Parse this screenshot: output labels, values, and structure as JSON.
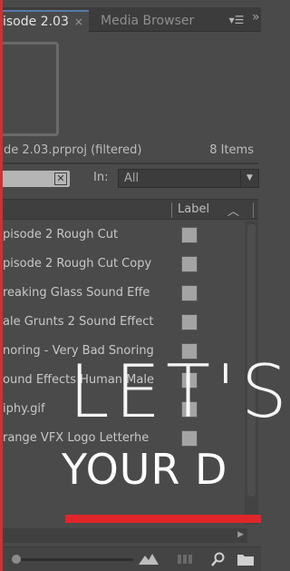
{
  "tabs": {
    "project_label": "isode 2.03",
    "close_glyph": "×",
    "media_label": "Media Browser",
    "menu_glyph": "▾☰",
    "overflow_glyph": "»"
  },
  "project": {
    "filename": "de 2.03.prproj (filtered)",
    "count": "8 Items"
  },
  "filter": {
    "clear_glyph": "✕",
    "in_label": "In:",
    "in_value": "All"
  },
  "list": {
    "label_header": "Label",
    "items": [
      {
        "name": "pisode 2 Rough Cut"
      },
      {
        "name": "pisode 2 Rough Cut Copy"
      },
      {
        "name": "reaking Glass Sound Effe"
      },
      {
        "name": "ale Grunts 2 Sound Effect"
      },
      {
        "name": "noring - Very Bad Snoring"
      },
      {
        "name": "ound Effects Human Male"
      },
      {
        "name": "iphy.gif"
      },
      {
        "name": "range VFX Logo Letterhe"
      }
    ]
  },
  "overlay": {
    "big_text": "LET'S",
    "sub_text": "YOUR D"
  },
  "colors": {
    "panel_bg": "#4a4a4a",
    "accent_red": "#e0262a",
    "label_swatch": "#a4a4a4"
  }
}
